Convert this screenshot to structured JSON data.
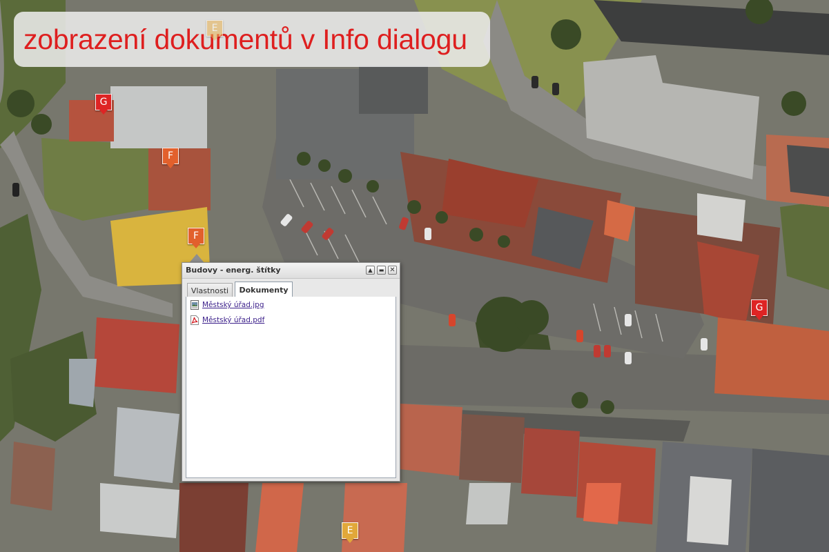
{
  "banner": {
    "text": "zobrazení dokumentů v Info dialogu"
  },
  "markers": [
    {
      "label": "E",
      "color": "#e8b352"
    },
    {
      "label": "G",
      "color": "#de2424"
    },
    {
      "label": "F",
      "color": "#e2602c"
    },
    {
      "label": "F",
      "color": "#e2602c"
    },
    {
      "label": "G",
      "color": "#de2424"
    },
    {
      "label": "E",
      "color": "#e1a83a"
    }
  ],
  "info_window": {
    "title": "Budovy - energ. štítky",
    "buttons": [
      "up-arrow-icon",
      "dock-icon",
      "close-icon"
    ],
    "tabs": [
      {
        "label": "Vlastnosti",
        "active": false
      },
      {
        "label": "Dokumenty",
        "active": true
      }
    ],
    "documents": [
      {
        "name": "Městský úřad.jpg",
        "icon": "image-file-icon"
      },
      {
        "name": "Městský úřad.pdf",
        "icon": "pdf-file-icon"
      }
    ]
  }
}
